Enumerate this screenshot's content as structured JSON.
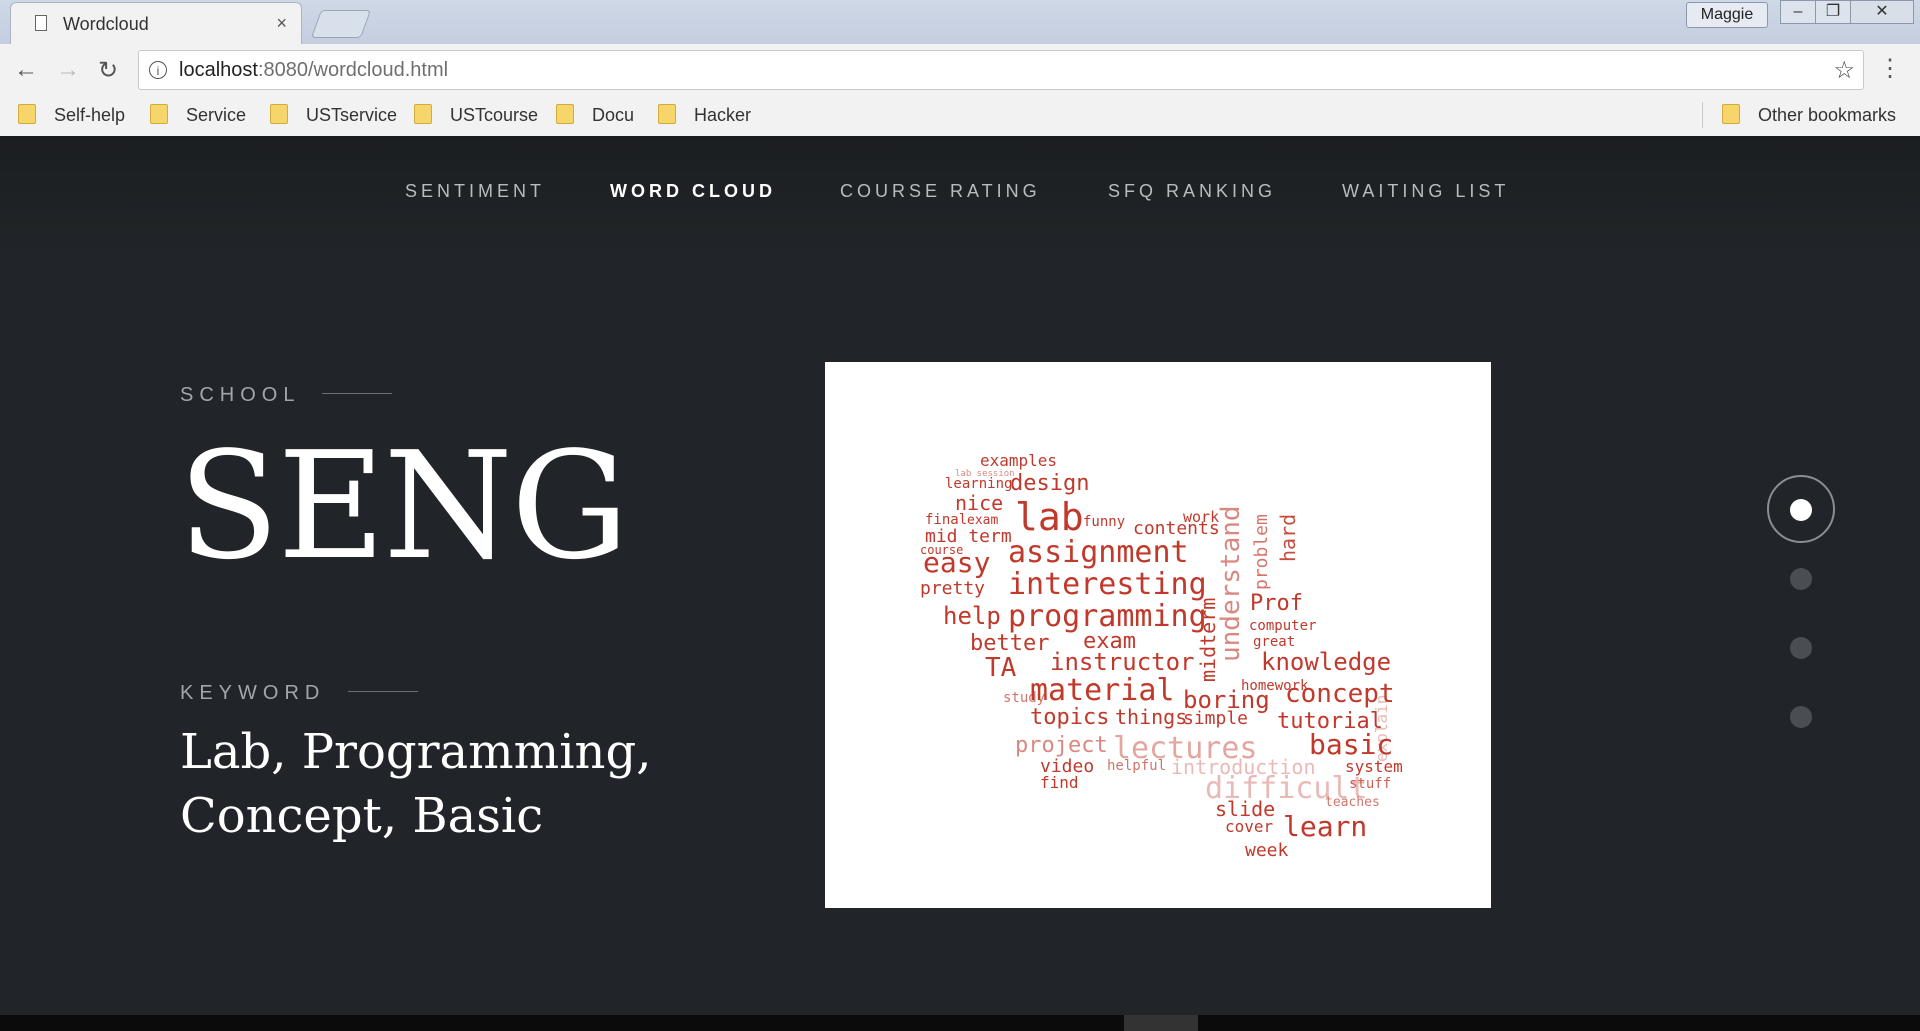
{
  "browser": {
    "tab_title": "Wordcloud",
    "tab_close": "×",
    "profile": "Maggie",
    "url_host": "localhost",
    "url_path": ":8080/wordcloud.html",
    "bookmarks": [
      "Self-help",
      "Service",
      "USTservice",
      "USTcourse",
      "Docu",
      "Hacker"
    ],
    "other_bookmarks": "Other bookmarks"
  },
  "nav": {
    "items": [
      "SENTIMENT",
      "WORD CLOUD",
      "COURSE RATING",
      "SFQ RANKING",
      "WAITING LIST"
    ],
    "active": "WORD CLOUD"
  },
  "school": {
    "label": "SCHOOL",
    "value": "SENG"
  },
  "keyword": {
    "label": "KEYWORD",
    "line1": "Lab, Programming,",
    "line2": "Concept, Basic"
  },
  "wordcloud": {
    "words": [
      "examples",
      "lab session",
      "learning",
      "design",
      "nice",
      "final",
      "exam",
      "lab",
      "funny",
      "contents",
      "work",
      "mid term",
      "easy",
      "assignment",
      "pretty",
      "interesting",
      "Prof",
      "help",
      "programming",
      "understand",
      "problem",
      "hard",
      "better",
      "exam",
      "computer",
      "great",
      "TA",
      "instructor",
      "midterm",
      "knowledge",
      "material",
      "boring",
      "concept",
      "study",
      "topics",
      "things",
      "simple",
      "tutorial",
      "project",
      "lectures",
      "basic",
      "video",
      "helpful",
      "introduction",
      "system",
      "find",
      "difficult",
      "stuff",
      "slide",
      "teaches",
      "cover",
      "learn",
      "week",
      "explain",
      "course",
      "homework"
    ],
    "color": "#c0392b"
  },
  "pager": {
    "count": 4,
    "active_index": 0
  },
  "colors": {
    "background": "#212529",
    "accent": "#ffffff"
  }
}
